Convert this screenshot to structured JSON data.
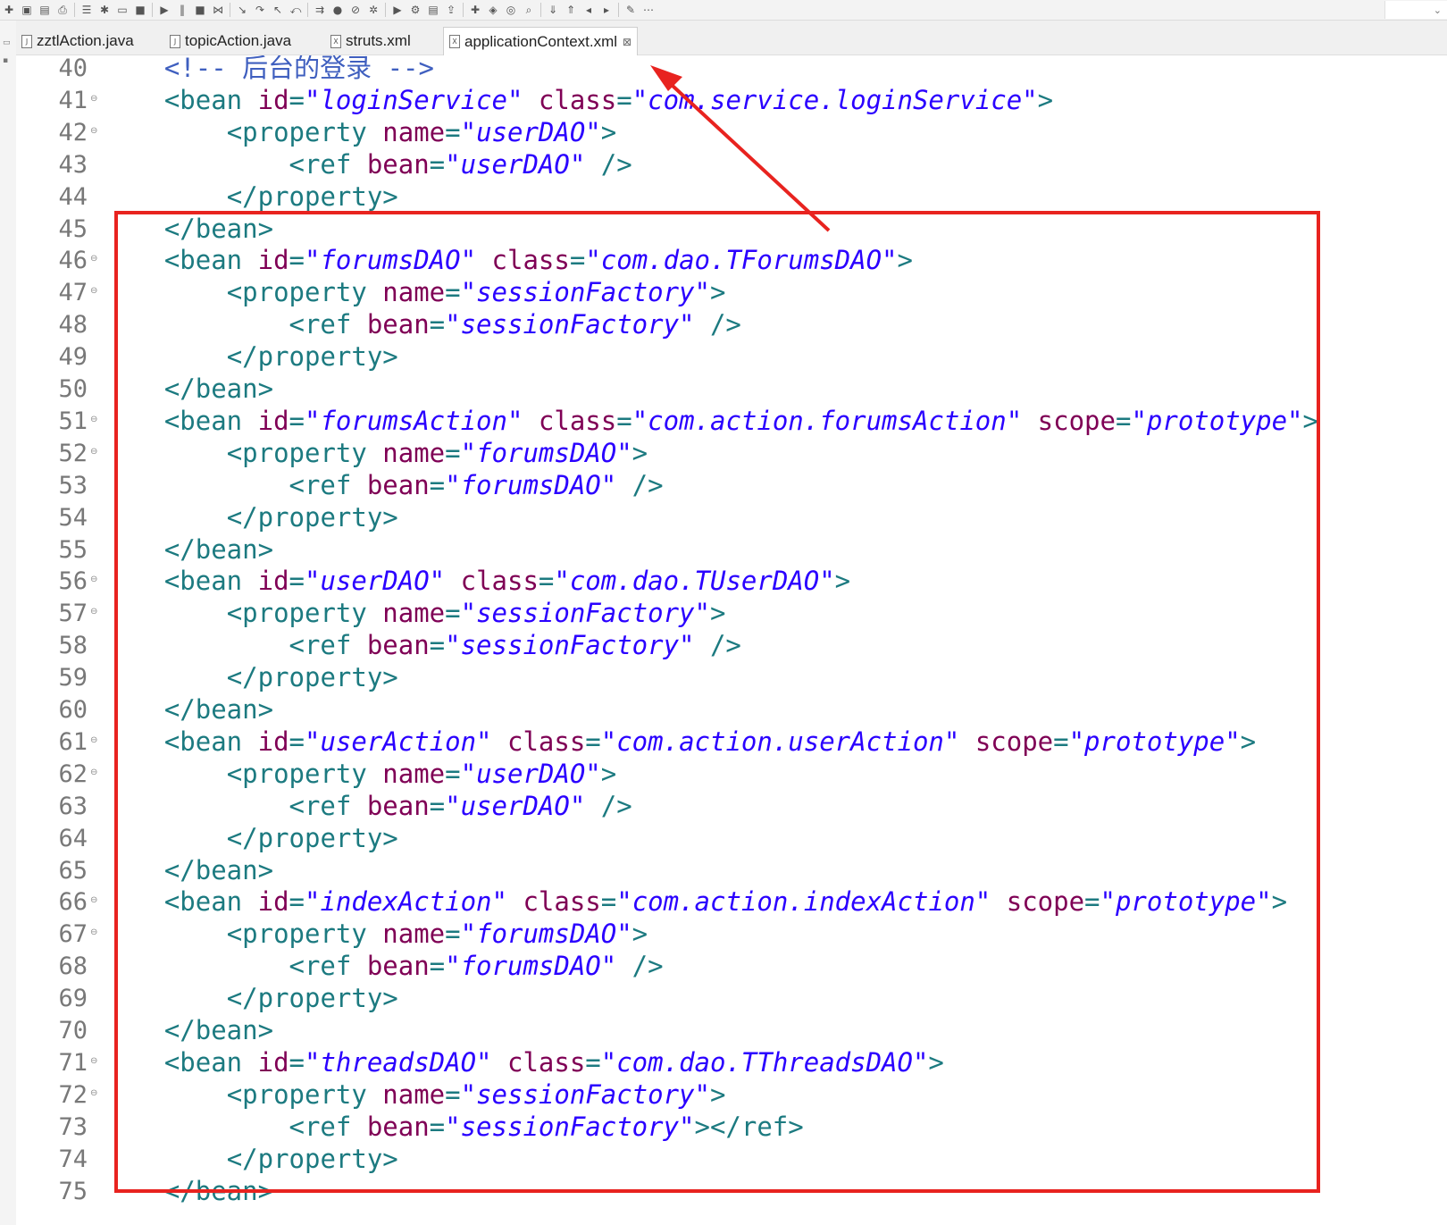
{
  "toolbar": {
    "icons": [
      "new-icon",
      "save-icon",
      "save-all-icon",
      "print-icon",
      "properties-icon",
      "debug-icon",
      "console-icon",
      "terminate-icon",
      "resume-icon",
      "suspend-icon",
      "stop-icon",
      "disconnect-icon",
      "step-into-icon",
      "step-over-icon",
      "step-return-icon",
      "drop-frame-icon",
      "use-step-filters-icon",
      "run-icon",
      "skip-breakpoints-icon",
      "debug-as-icon",
      "run-as-icon",
      "external-tools-icon",
      "server-icon",
      "deploy-icon",
      "new-server-icon",
      "open-type-icon",
      "open-task-icon",
      "search-icon",
      "next-annotation-icon",
      "previous-annotation-icon",
      "back-icon",
      "forward-icon",
      "pin-editor-icon",
      "perspective-icon"
    ]
  },
  "tabs": [
    {
      "label": "zztlAction.java",
      "icon": "java-file-icon",
      "active": false
    },
    {
      "label": "topicAction.java",
      "icon": "java-file-icon",
      "active": false
    },
    {
      "label": "struts.xml",
      "icon": "xml-file-icon",
      "active": false
    },
    {
      "label": "applicationContext.xml",
      "icon": "xml-file-icon",
      "active": true,
      "close": "⊠"
    }
  ],
  "editor": {
    "lines": [
      {
        "n": "40",
        "fold": false,
        "tokens": [
          [
            "plain",
            "    "
          ],
          [
            "cmt",
            "<!-- 后台的登录 -->"
          ]
        ]
      },
      {
        "n": "41",
        "fold": true,
        "tokens": [
          [
            "plain",
            "    "
          ],
          [
            "tag",
            "<bean "
          ],
          [
            "attr",
            "id"
          ],
          [
            "plain",
            "="
          ],
          [
            "val",
            "\"loginService\""
          ],
          [
            "plain",
            " "
          ],
          [
            "attr",
            "class"
          ],
          [
            "plain",
            "="
          ],
          [
            "val",
            "\"com.service.loginService\""
          ],
          [
            "tag",
            ">"
          ]
        ]
      },
      {
        "n": "42",
        "fold": true,
        "tokens": [
          [
            "plain",
            "        "
          ],
          [
            "tag",
            "<property "
          ],
          [
            "attr",
            "name"
          ],
          [
            "plain",
            "="
          ],
          [
            "val",
            "\"userDAO\""
          ],
          [
            "tag",
            ">"
          ]
        ]
      },
      {
        "n": "43",
        "fold": false,
        "tokens": [
          [
            "plain",
            "            "
          ],
          [
            "tag",
            "<ref "
          ],
          [
            "attr",
            "bean"
          ],
          [
            "plain",
            "="
          ],
          [
            "val",
            "\"userDAO\""
          ],
          [
            "plain",
            " "
          ],
          [
            "tag",
            "/>"
          ]
        ]
      },
      {
        "n": "44",
        "fold": false,
        "tokens": [
          [
            "plain",
            "        "
          ],
          [
            "tag",
            "</property>"
          ]
        ]
      },
      {
        "n": "45",
        "fold": false,
        "tokens": [
          [
            "plain",
            "    "
          ],
          [
            "tag",
            "</bean>"
          ]
        ]
      },
      {
        "n": "46",
        "fold": true,
        "tokens": [
          [
            "plain",
            "    "
          ],
          [
            "tag",
            "<bean "
          ],
          [
            "attr",
            "id"
          ],
          [
            "plain",
            "="
          ],
          [
            "val",
            "\"forumsDAO\""
          ],
          [
            "plain",
            " "
          ],
          [
            "attr",
            "class"
          ],
          [
            "plain",
            "="
          ],
          [
            "val",
            "\"com.dao.TForumsDAO\""
          ],
          [
            "tag",
            ">"
          ]
        ]
      },
      {
        "n": "47",
        "fold": true,
        "tokens": [
          [
            "plain",
            "        "
          ],
          [
            "tag",
            "<property "
          ],
          [
            "attr",
            "name"
          ],
          [
            "plain",
            "="
          ],
          [
            "val",
            "\"sessionFactory\""
          ],
          [
            "tag",
            ">"
          ]
        ]
      },
      {
        "n": "48",
        "fold": false,
        "tokens": [
          [
            "plain",
            "            "
          ],
          [
            "tag",
            "<ref "
          ],
          [
            "attr",
            "bean"
          ],
          [
            "plain",
            "="
          ],
          [
            "val",
            "\"sessionFactory\""
          ],
          [
            "plain",
            " "
          ],
          [
            "tag",
            "/>"
          ]
        ]
      },
      {
        "n": "49",
        "fold": false,
        "tokens": [
          [
            "plain",
            "        "
          ],
          [
            "tag",
            "</property>"
          ]
        ]
      },
      {
        "n": "50",
        "fold": false,
        "tokens": [
          [
            "plain",
            "    "
          ],
          [
            "tag",
            "</bean>"
          ]
        ]
      },
      {
        "n": "51",
        "fold": true,
        "tokens": [
          [
            "plain",
            "    "
          ],
          [
            "tag",
            "<bean "
          ],
          [
            "attr",
            "id"
          ],
          [
            "plain",
            "="
          ],
          [
            "val",
            "\"forumsAction\""
          ],
          [
            "plain",
            " "
          ],
          [
            "attr",
            "class"
          ],
          [
            "plain",
            "="
          ],
          [
            "val",
            "\"com.action.forumsAction\""
          ],
          [
            "plain",
            " "
          ],
          [
            "attr",
            "scope"
          ],
          [
            "plain",
            "="
          ],
          [
            "val",
            "\"prototype\""
          ],
          [
            "tag",
            ">"
          ]
        ]
      },
      {
        "n": "52",
        "fold": true,
        "tokens": [
          [
            "plain",
            "        "
          ],
          [
            "tag",
            "<property "
          ],
          [
            "attr",
            "name"
          ],
          [
            "plain",
            "="
          ],
          [
            "val",
            "\"forumsDAO\""
          ],
          [
            "tag",
            ">"
          ]
        ]
      },
      {
        "n": "53",
        "fold": false,
        "tokens": [
          [
            "plain",
            "            "
          ],
          [
            "tag",
            "<ref "
          ],
          [
            "attr",
            "bean"
          ],
          [
            "plain",
            "="
          ],
          [
            "val",
            "\"forumsDAO\""
          ],
          [
            "plain",
            " "
          ],
          [
            "tag",
            "/>"
          ]
        ]
      },
      {
        "n": "54",
        "fold": false,
        "tokens": [
          [
            "plain",
            "        "
          ],
          [
            "tag",
            "</property>"
          ]
        ]
      },
      {
        "n": "55",
        "fold": false,
        "tokens": [
          [
            "plain",
            "    "
          ],
          [
            "tag",
            "</bean>"
          ]
        ]
      },
      {
        "n": "56",
        "fold": true,
        "tokens": [
          [
            "plain",
            "    "
          ],
          [
            "tag",
            "<bean "
          ],
          [
            "attr",
            "id"
          ],
          [
            "plain",
            "="
          ],
          [
            "val",
            "\"userDAO\""
          ],
          [
            "plain",
            " "
          ],
          [
            "attr",
            "class"
          ],
          [
            "plain",
            "="
          ],
          [
            "val",
            "\"com.dao.TUserDAO\""
          ],
          [
            "tag",
            ">"
          ]
        ]
      },
      {
        "n": "57",
        "fold": true,
        "tokens": [
          [
            "plain",
            "        "
          ],
          [
            "tag",
            "<property "
          ],
          [
            "attr",
            "name"
          ],
          [
            "plain",
            "="
          ],
          [
            "val",
            "\"sessionFactory\""
          ],
          [
            "tag",
            ">"
          ]
        ]
      },
      {
        "n": "58",
        "fold": false,
        "tokens": [
          [
            "plain",
            "            "
          ],
          [
            "tag",
            "<ref "
          ],
          [
            "attr",
            "bean"
          ],
          [
            "plain",
            "="
          ],
          [
            "val",
            "\"sessionFactory\""
          ],
          [
            "plain",
            " "
          ],
          [
            "tag",
            "/>"
          ]
        ]
      },
      {
        "n": "59",
        "fold": false,
        "tokens": [
          [
            "plain",
            "        "
          ],
          [
            "tag",
            "</property>"
          ]
        ]
      },
      {
        "n": "60",
        "fold": false,
        "tokens": [
          [
            "plain",
            "    "
          ],
          [
            "tag",
            "</bean>"
          ]
        ]
      },
      {
        "n": "61",
        "fold": true,
        "tokens": [
          [
            "plain",
            "    "
          ],
          [
            "tag",
            "<bean "
          ],
          [
            "attr",
            "id"
          ],
          [
            "plain",
            "="
          ],
          [
            "val",
            "\"userAction\""
          ],
          [
            "plain",
            " "
          ],
          [
            "attr",
            "class"
          ],
          [
            "plain",
            "="
          ],
          [
            "val",
            "\"com.action.userAction\""
          ],
          [
            "plain",
            " "
          ],
          [
            "attr",
            "scope"
          ],
          [
            "plain",
            "="
          ],
          [
            "val",
            "\"prototype\""
          ],
          [
            "tag",
            ">"
          ]
        ]
      },
      {
        "n": "62",
        "fold": true,
        "tokens": [
          [
            "plain",
            "        "
          ],
          [
            "tag",
            "<property "
          ],
          [
            "attr",
            "name"
          ],
          [
            "plain",
            "="
          ],
          [
            "val",
            "\"userDAO\""
          ],
          [
            "tag",
            ">"
          ]
        ]
      },
      {
        "n": "63",
        "fold": false,
        "tokens": [
          [
            "plain",
            "            "
          ],
          [
            "tag",
            "<ref "
          ],
          [
            "attr",
            "bean"
          ],
          [
            "plain",
            "="
          ],
          [
            "val",
            "\"userDAO\""
          ],
          [
            "plain",
            " "
          ],
          [
            "tag",
            "/>"
          ]
        ]
      },
      {
        "n": "64",
        "fold": false,
        "tokens": [
          [
            "plain",
            "        "
          ],
          [
            "tag",
            "</property>"
          ]
        ]
      },
      {
        "n": "65",
        "fold": false,
        "tokens": [
          [
            "plain",
            "    "
          ],
          [
            "tag",
            "</bean>"
          ]
        ]
      },
      {
        "n": "66",
        "fold": true,
        "tokens": [
          [
            "plain",
            "    "
          ],
          [
            "tag",
            "<bean "
          ],
          [
            "attr",
            "id"
          ],
          [
            "plain",
            "="
          ],
          [
            "val",
            "\"indexAction\""
          ],
          [
            "plain",
            " "
          ],
          [
            "attr",
            "class"
          ],
          [
            "plain",
            "="
          ],
          [
            "val",
            "\"com.action.indexAction\""
          ],
          [
            "plain",
            " "
          ],
          [
            "attr",
            "scope"
          ],
          [
            "plain",
            "="
          ],
          [
            "val",
            "\"prototype\""
          ],
          [
            "tag",
            ">"
          ]
        ]
      },
      {
        "n": "67",
        "fold": true,
        "tokens": [
          [
            "plain",
            "        "
          ],
          [
            "tag",
            "<property "
          ],
          [
            "attr",
            "name"
          ],
          [
            "plain",
            "="
          ],
          [
            "val",
            "\"forumsDAO\""
          ],
          [
            "tag",
            ">"
          ]
        ]
      },
      {
        "n": "68",
        "fold": false,
        "tokens": [
          [
            "plain",
            "            "
          ],
          [
            "tag",
            "<ref "
          ],
          [
            "attr",
            "bean"
          ],
          [
            "plain",
            "="
          ],
          [
            "val",
            "\"forumsDAO\""
          ],
          [
            "plain",
            " "
          ],
          [
            "tag",
            "/>"
          ]
        ]
      },
      {
        "n": "69",
        "fold": false,
        "tokens": [
          [
            "plain",
            "        "
          ],
          [
            "tag",
            "</property>"
          ]
        ]
      },
      {
        "n": "70",
        "fold": false,
        "tokens": [
          [
            "plain",
            "    "
          ],
          [
            "tag",
            "</bean>"
          ]
        ]
      },
      {
        "n": "71",
        "fold": true,
        "tokens": [
          [
            "plain",
            "    "
          ],
          [
            "tag",
            "<bean "
          ],
          [
            "attr",
            "id"
          ],
          [
            "plain",
            "="
          ],
          [
            "val",
            "\"threadsDAO\""
          ],
          [
            "plain",
            " "
          ],
          [
            "attr",
            "class"
          ],
          [
            "plain",
            "="
          ],
          [
            "val",
            "\"com.dao.TThreadsDAO\""
          ],
          [
            "tag",
            ">"
          ]
        ]
      },
      {
        "n": "72",
        "fold": true,
        "tokens": [
          [
            "plain",
            "        "
          ],
          [
            "tag",
            "<property "
          ],
          [
            "attr",
            "name"
          ],
          [
            "plain",
            "="
          ],
          [
            "val",
            "\"sessionFactory\""
          ],
          [
            "tag",
            ">"
          ]
        ]
      },
      {
        "n": "73",
        "fold": false,
        "tokens": [
          [
            "plain",
            "            "
          ],
          [
            "tag",
            "<ref "
          ],
          [
            "attr",
            "bean"
          ],
          [
            "plain",
            "="
          ],
          [
            "val",
            "\"sessionFactory\""
          ],
          [
            "tag",
            "></ref>"
          ]
        ]
      },
      {
        "n": "74",
        "fold": false,
        "tokens": [
          [
            "plain",
            "        "
          ],
          [
            "tag",
            "</property>"
          ]
        ]
      },
      {
        "n": "75",
        "fold": false,
        "tokens": [
          [
            "plain",
            "    "
          ],
          [
            "tag",
            "</bean>"
          ]
        ]
      }
    ]
  },
  "colors": {
    "tag": "#1c7a80",
    "attribute": "#7f0055",
    "value": "#2a00ff",
    "comment": "#3f5fbf",
    "line_number": "#787878",
    "annotation": "#e8231f"
  },
  "annotations": [
    {
      "type": "highlight-rectangle",
      "color": "#e8231f"
    },
    {
      "type": "arrow",
      "color": "#e8231f",
      "points_to": "applicationContext.xml tab"
    }
  ]
}
